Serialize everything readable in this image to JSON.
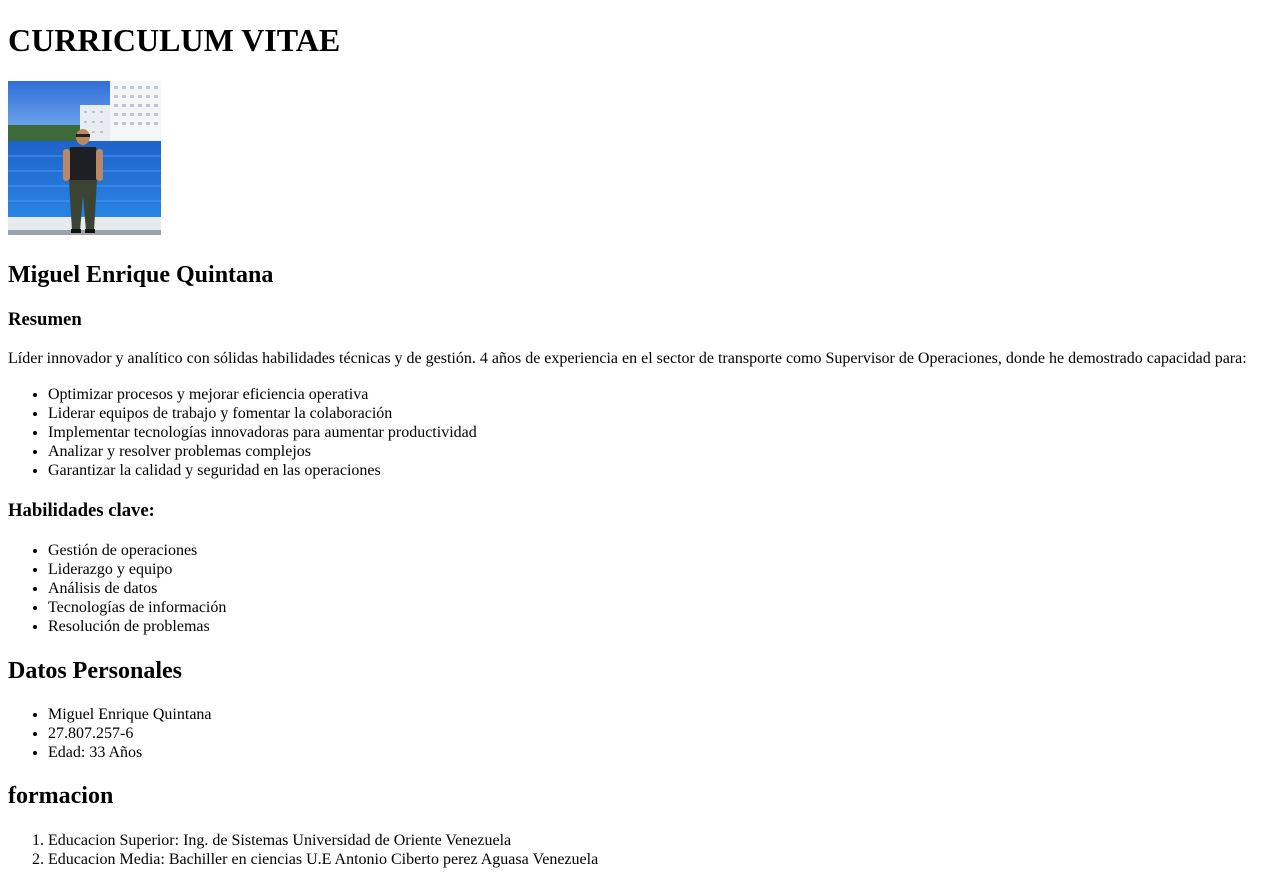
{
  "title": "CURRICULUM VITAE",
  "photo": {
    "description_icon": "profile-photo"
  },
  "name": "Miguel Enrique Quintana",
  "resumen": {
    "heading": "Resumen",
    "text": "Líder innovador y analítico con sólidas habilidades técnicas y de gestión. 4 años de experiencia en el sector de transporte como Supervisor de Operaciones, donde he demostrado capacidad para:",
    "items": [
      "Optimizar procesos y mejorar eficiencia operativa",
      "Liderar equipos de trabajo y fomentar la colaboración",
      "Implementar tecnologías innovadoras para aumentar productividad",
      "Analizar y resolver problemas complejos",
      "Garantizar la calidad y seguridad en las operaciones"
    ]
  },
  "habilidades": {
    "heading": "Habilidades clave:",
    "items": [
      "Gestión de operaciones",
      "Liderazgo y equipo",
      "Análisis de datos",
      "Tecnologías de información",
      "Resolución de problemas"
    ]
  },
  "datos": {
    "heading": "Datos Personales",
    "items": [
      "Miguel Enrique Quintana",
      "27.807.257-6",
      "Edad: 33 Años"
    ]
  },
  "formacion": {
    "heading": "formacion",
    "items": [
      "Educacion Superior: Ing. de Sistemas Universidad de Oriente Venezuela",
      "Educacion Media: Bachiller en ciencias U.E Antonio Ciberto perez Aguasa Venezuela"
    ]
  }
}
